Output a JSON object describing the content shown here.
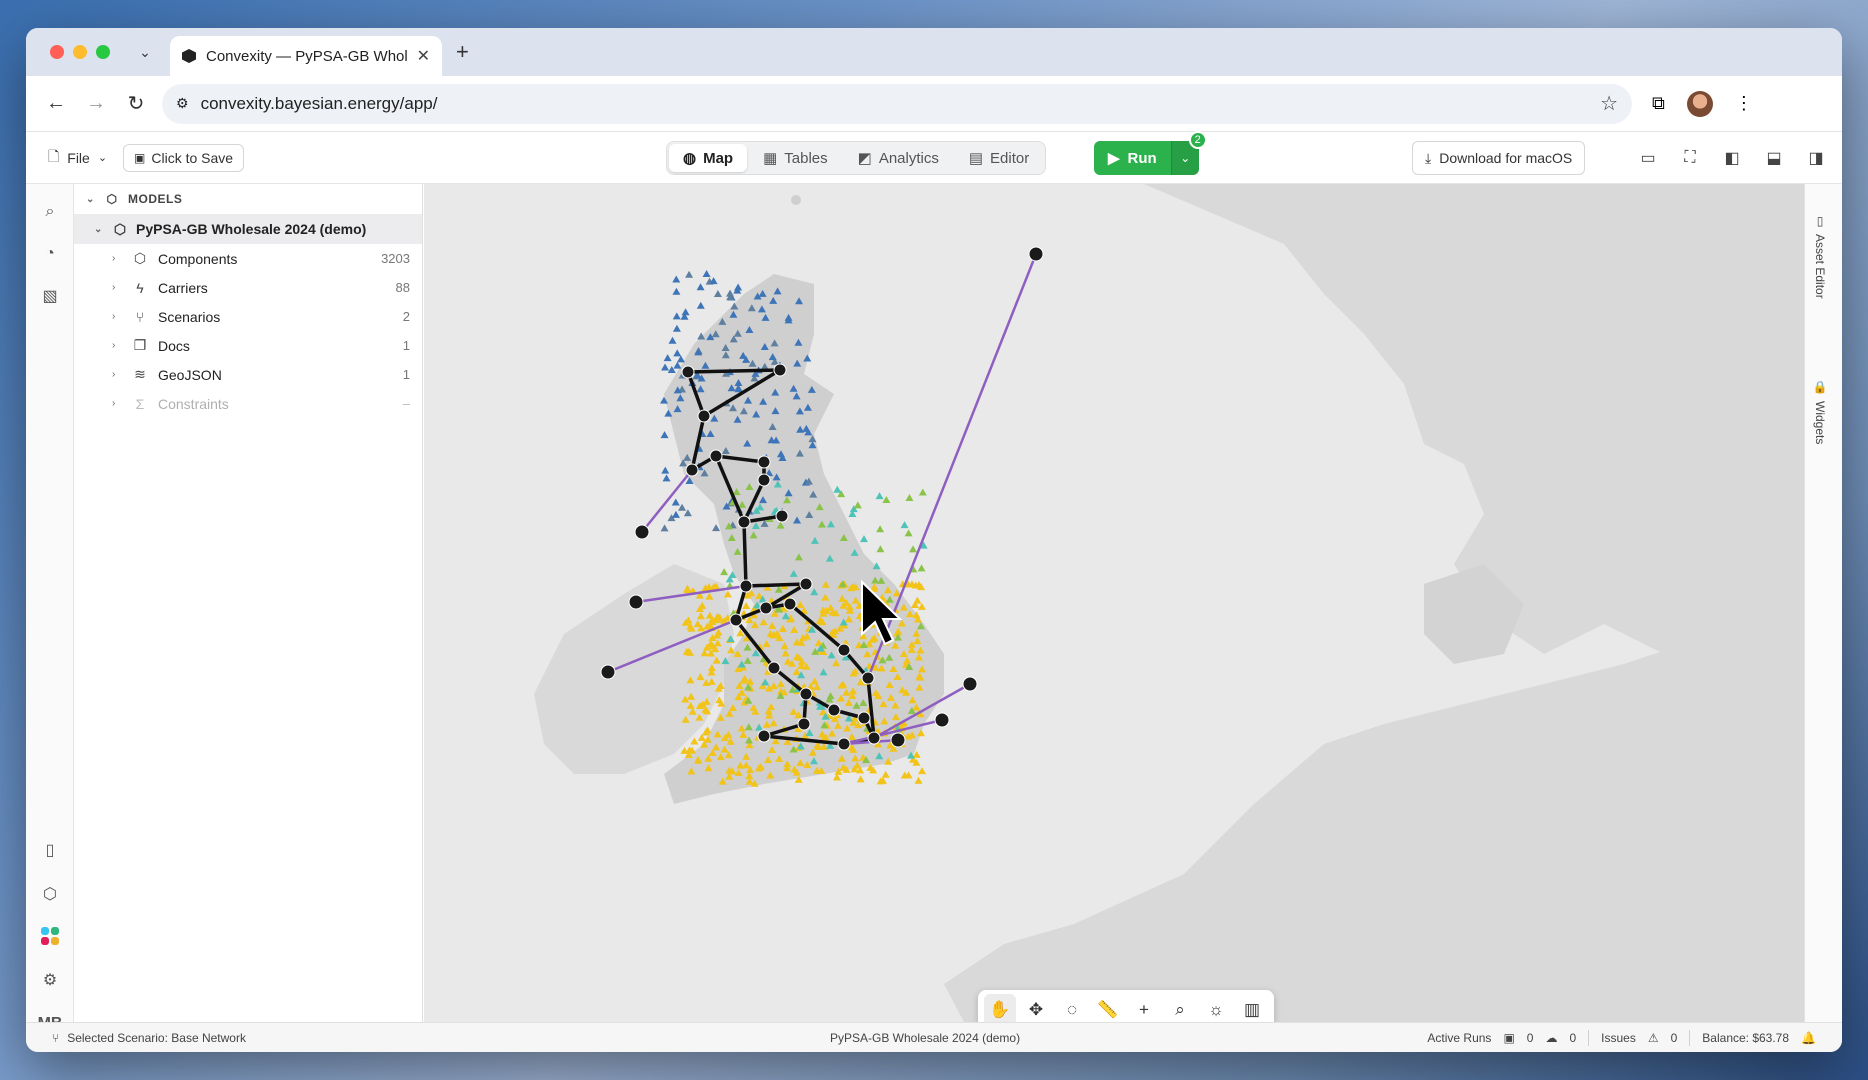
{
  "browser": {
    "tab_title": "Convexity — PyPSA-GB Whol",
    "url": "convexity.bayesian.energy/app/"
  },
  "toolbar": {
    "file_label": "File",
    "save_label": "Click to Save",
    "view_tabs": [
      {
        "label": "Map",
        "icon": "globe-icon",
        "active": true
      },
      {
        "label": "Tables",
        "icon": "table-icon",
        "active": false
      },
      {
        "label": "Analytics",
        "icon": "chart-icon",
        "active": false
      },
      {
        "label": "Editor",
        "icon": "document-icon",
        "active": false
      }
    ],
    "run_label": "Run",
    "run_badge": "2",
    "download_label": "Download for macOS"
  },
  "sidebar": {
    "section_title": "MODELS",
    "model_name": "PyPSA-GB Wholesale 2024 (demo)",
    "items": [
      {
        "label": "Components",
        "count": "3203",
        "icon": "cube-icon"
      },
      {
        "label": "Carriers",
        "count": "88",
        "icon": "bolt-icon"
      },
      {
        "label": "Scenarios",
        "count": "2",
        "icon": "branch-icon"
      },
      {
        "label": "Docs",
        "count": "1",
        "icon": "docs-icon"
      },
      {
        "label": "GeoJSON",
        "count": "1",
        "icon": "layers-icon"
      },
      {
        "label": "Constraints",
        "count": "–",
        "icon": "sigma-icon"
      }
    ]
  },
  "right_rail": {
    "asset_editor": "Asset Editor",
    "widgets": "Widgets"
  },
  "left_rail": {
    "user_initials": "MB"
  },
  "status": {
    "scenario": "Selected Scenario: Base Network",
    "model": "PyPSA-GB Wholesale 2024 (demo)",
    "active_runs_label": "Active Runs",
    "runs_a": "0",
    "runs_b": "0",
    "issues_label": "Issues",
    "issues_count": "0",
    "balance": "Balance: $63.78"
  },
  "colors": {
    "run_green": "#2bb24c",
    "interconnector": "#8e5fc0",
    "solar": "#f2c318",
    "wind": "#3e74b8",
    "bus": "#1a1a1a"
  }
}
